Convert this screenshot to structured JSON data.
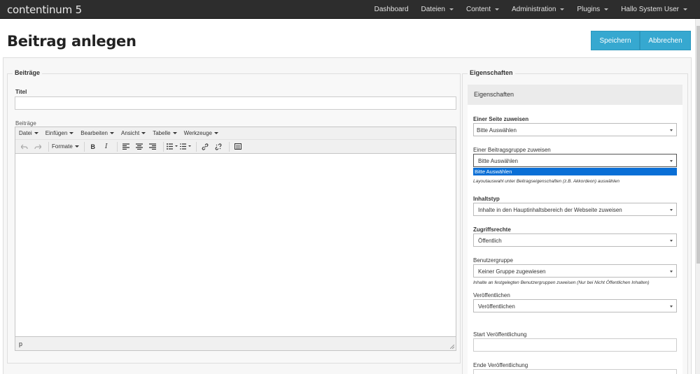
{
  "navbar": {
    "brand": "contentinum 5",
    "items": [
      {
        "label": "Dashboard",
        "dropdown": false
      },
      {
        "label": "Dateien",
        "dropdown": true
      },
      {
        "label": "Content",
        "dropdown": true
      },
      {
        "label": "Administration",
        "dropdown": true
      },
      {
        "label": "Plugins",
        "dropdown": true
      },
      {
        "label": "Hallo System User",
        "dropdown": true
      }
    ]
  },
  "header": {
    "title": "Beitrag anlegen",
    "save_label": "Speichern",
    "cancel_label": "Abbrechen"
  },
  "colors": {
    "navbar_bg": "#2d2d2d",
    "button_bg": "#36a8d0",
    "dropdown_highlight": "#0a6fd6"
  },
  "left": {
    "legend": "Beiträge",
    "title_label": "Titel",
    "title_value": "",
    "content_label": "Beiträge",
    "editor": {
      "menu": [
        "Datei",
        "Einfügen",
        "Bearbeiten",
        "Ansicht",
        "Tabelle",
        "Werkzeuge"
      ],
      "formats_label": "Formate",
      "toolbar_icons": [
        "undo-icon",
        "redo-icon",
        "bold-icon",
        "italic-icon",
        "align-left-icon",
        "align-center-icon",
        "align-right-icon",
        "bullet-list-icon",
        "numbered-list-icon",
        "link-icon",
        "unlink-icon",
        "code-icon"
      ],
      "status_path": "p"
    }
  },
  "right": {
    "legend": "Eigenschaften",
    "panel_title": "Eigenschaften",
    "page_label": "Einer Seite zuweisen",
    "page_value": "Bitte Auswählen",
    "group_label": "Einer Beitragsgruppe zuweisen",
    "group_value": "Bitte Auswählen",
    "group_dropdown_option": "Bitte Auswählen",
    "group_hint": "Layoutauswahl unter Beitragseigenschaften (z.B. Akkordeon) auswählen",
    "type_label": "Inhaltstyp",
    "type_value": "Inhalte in den Hauptinhaltsbereich der Webseite zuweisen",
    "access_label": "Zugriffsrechte",
    "access_value": "Öffentlich",
    "usergroup_label": "Benutzergruppe",
    "usergroup_value": "Keiner Gruppe zugewiesen",
    "usergroup_hint": "Inhalte an festgelegten Benutzergruppen zuweisen (Nur bei Nicht Öffentlichen Inhalten)",
    "publish_label": "Veröffentlichen",
    "publish_value": "Veröffentlichen",
    "start_label": "Start Veröffentlichung",
    "start_value": "",
    "end_label": "Ende Veröffentlichung"
  }
}
